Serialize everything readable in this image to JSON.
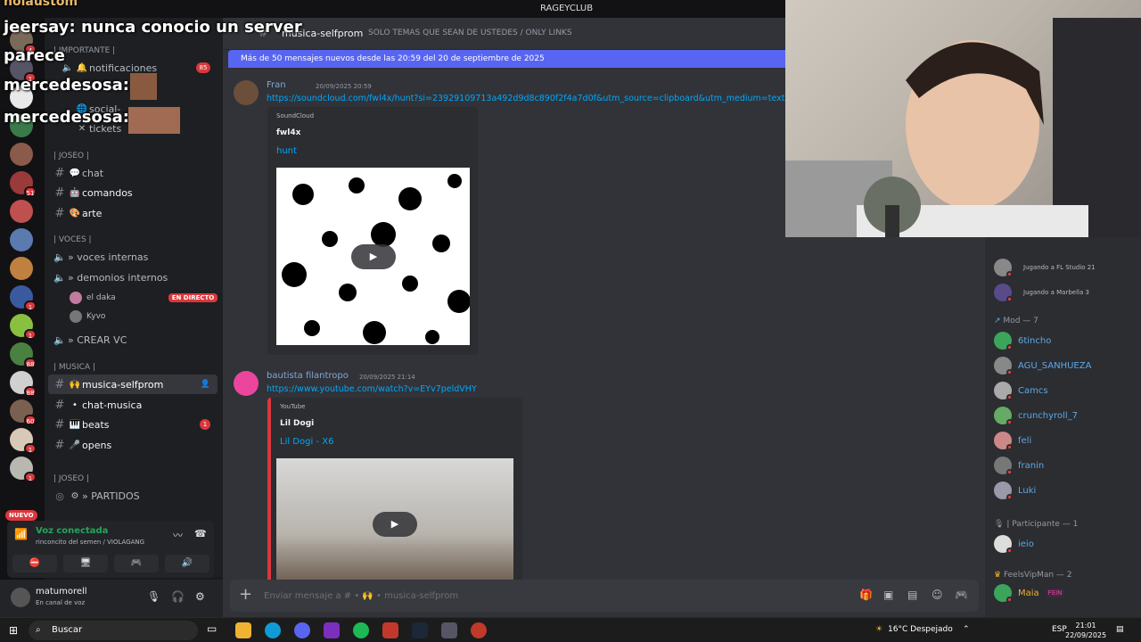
{
  "titlebar": {
    "title": "RAGEYCLUB"
  },
  "stream_overlay": {
    "lines": [
      "jeersay: nunca conocio un server",
      "parece",
      "mercedesosa:",
      "mercedesosa:"
    ],
    "top_text": "noiaustom"
  },
  "rail": {
    "servers": [
      {
        "badge": "4"
      },
      {
        "badge": "1"
      },
      {
        "badge": ""
      },
      {
        "badge": ""
      },
      {
        "badge": ""
      },
      {
        "badge": "51"
      },
      {
        "badge": ""
      },
      {
        "badge": ""
      },
      {
        "badge": ""
      },
      {
        "badge": "1"
      },
      {
        "badge": "1"
      },
      {
        "badge": "88"
      },
      {
        "badge": "88"
      },
      {
        "badge": "60"
      },
      {
        "badge": "1"
      },
      {
        "badge": "1"
      }
    ],
    "new_label": "NUEVO"
  },
  "channels": {
    "categories": [
      {
        "label": "| IMPORTANTE |"
      },
      {
        "label": "| JOSEO |"
      },
      {
        "label": "| VOCES |"
      },
      {
        "label": "| MUSICA |"
      },
      {
        "label": "| JOSEO |"
      }
    ],
    "items": [
      {
        "label": "notificaciones",
        "count": "85"
      },
      {
        "label": "social-"
      },
      {
        "label": "tickets"
      },
      {
        "label": "chat"
      },
      {
        "label": "comandos"
      },
      {
        "label": "arte"
      },
      {
        "label": "» voces internas"
      },
      {
        "label": "» demonios internos"
      },
      {
        "label": "» CREAR VC"
      },
      {
        "label": "musica-selfprom"
      },
      {
        "label": "chat-musica"
      },
      {
        "label": "beats",
        "count": "1"
      },
      {
        "label": "opens"
      },
      {
        "label": "» PARTIDOS"
      }
    ],
    "voice_users": [
      {
        "name": "el daka",
        "live": "EN DIRECTO"
      },
      {
        "name": "Kyvo"
      }
    ]
  },
  "voice_panel": {
    "status": "Voz conectada",
    "sub": "rinconcito del semen / VIOLAGANG"
  },
  "user_panel": {
    "name": "matumorell",
    "status": "En canal de voz"
  },
  "chat": {
    "channel": "musica-selfprom",
    "topic": "SOLO TEMAS QUE SEAN DE USTEDES / ONLY LINKS",
    "new_messages": "Más de 50 mensajes nuevos desde las 20:59 del 20 de septiembre de 2025",
    "messages": [
      {
        "author": "Fran",
        "time": "20/09/2025 20:59",
        "link": "https://soundcloud.com/fwl4x/hunt?si=23929109713a492d9d8c890f2f4a7d0f&utm_source=clipboard&utm_medium=text&utm_",
        "embed": {
          "provider": "SoundCloud",
          "author": "fwl4x",
          "title": "hunt"
        }
      },
      {
        "author": "bautista filantropo",
        "time": "20/09/2025 21:14",
        "link": "https://www.youtube.com/watch?v=EYv7peldVHY",
        "embed": {
          "provider": "YouTube",
          "author": "Lil Dogi",
          "title": "Lil Dogi - X6"
        }
      }
    ],
    "composer_placeholder": "Enviar mensaje a # • 🙌 • musica-selfprom"
  },
  "members": {
    "activities": [
      "Jugando a FL Studio 21",
      "Jugando a Marbella 3"
    ],
    "mod_header": "Mod — 7",
    "mods": [
      "6tincho",
      "AGU_SANHUEZA",
      "Camcs",
      "crunchyroll_7",
      "feli",
      "franin",
      "Luki"
    ],
    "participant_header": "| Participante — 1",
    "participants": [
      "ieio"
    ],
    "vip_header": "FeelsVipMan — 2",
    "vips": [
      {
        "name": "Maia",
        "tag": "FEIN"
      }
    ]
  },
  "taskbar": {
    "search": "Buscar",
    "weather": "16°C  Despejado",
    "lang": "ESP",
    "time": "21:01",
    "date": "22/09/2025"
  },
  "colors": {
    "accent": "#5865f2",
    "danger": "#da373c",
    "link": "#00a8fc",
    "online": "#23a55a"
  }
}
